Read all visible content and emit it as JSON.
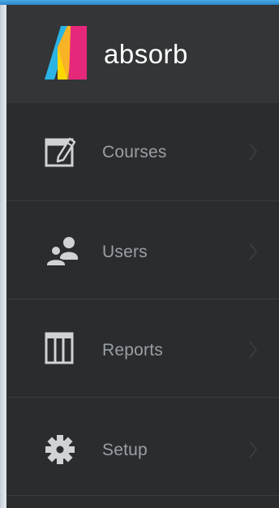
{
  "app": {
    "brand_name": "absorb",
    "accent_color": "#2b86c9",
    "logo_colors": [
      "#2bb3e6",
      "#ffd700",
      "#e6287a"
    ]
  },
  "nav": {
    "items": [
      {
        "label": "Courses",
        "icon": "courses-edit-icon"
      },
      {
        "label": "Users",
        "icon": "users-icon"
      },
      {
        "label": "Reports",
        "icon": "reports-table-icon"
      },
      {
        "label": "Setup",
        "icon": "gear-icon"
      }
    ]
  }
}
